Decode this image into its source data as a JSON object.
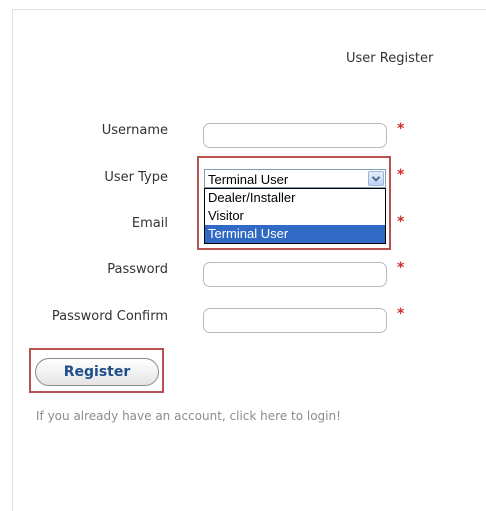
{
  "page": {
    "title": "User Register"
  },
  "form": {
    "username_label": "Username",
    "username_value": "",
    "user_type_label": "User Type",
    "user_type_selected": "Terminal User",
    "user_type_options": [
      "Dealer/Installer",
      "Visitor",
      "Terminal User"
    ],
    "email_label": "Email",
    "email_value": "",
    "password_label": "Password",
    "password_value": "",
    "password_confirm_label": "Password Confirm",
    "password_confirm_value": "",
    "required_marker": "*"
  },
  "actions": {
    "register_label": "Register",
    "login_text": "If you already have an account, click here to login!"
  },
  "colors": {
    "highlight_border": "#b8514f",
    "required_marker": "#d22b2b",
    "selected_option_bg": "#316ac5",
    "register_text": "#1f4f8b"
  },
  "icons": {
    "dropdown": "chevron-down-icon"
  }
}
